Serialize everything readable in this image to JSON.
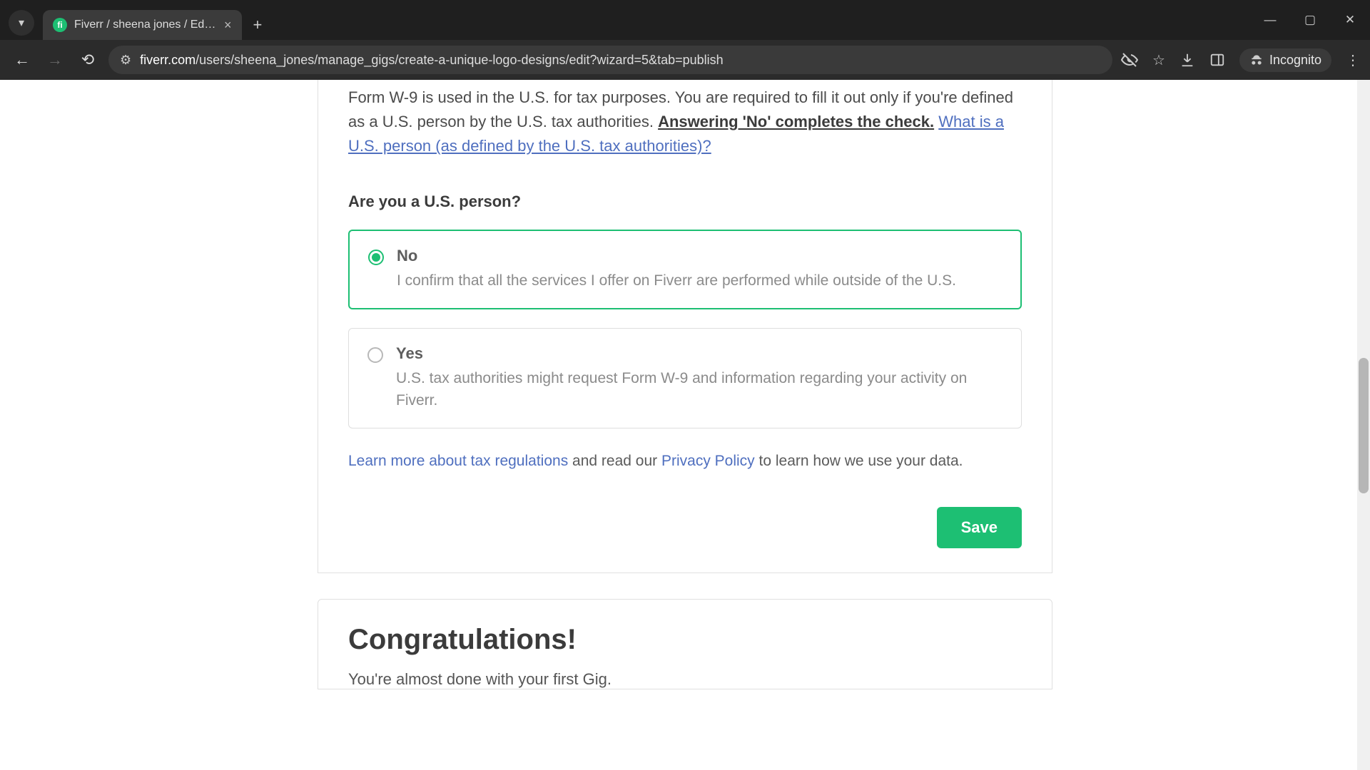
{
  "browser": {
    "tab_title": "Fiverr / sheena jones / Edit Gig",
    "url_host": "fiverr.com",
    "url_path": "/users/sheena_jones/manage_gigs/create-a-unique-logo-designs/edit?wizard=5&tab=publish",
    "incognito_label": "Incognito"
  },
  "form": {
    "intro_pre": "Form W-9 is used in the U.S. for tax purposes. You are required to fill it out only if you're defined as a U.S. person by the U.S. tax authorities. ",
    "intro_emph": "Answering 'No' completes the check.",
    "intro_link": "What is a U.S. person (as defined by the U.S. tax authorities)?",
    "question": "Are you a U.S. person?",
    "option_no": {
      "label": "No",
      "desc": "I confirm that all the services I offer on Fiverr are performed while outside of the U.S."
    },
    "option_yes": {
      "label": "Yes",
      "desc": "U.S. tax authorities might request Form W-9 and information regarding your activity on Fiverr."
    },
    "learn_link1": "Learn more about tax regulations",
    "learn_mid": " and read our ",
    "learn_link2": "Privacy Policy",
    "learn_tail": " to learn how we use your data.",
    "save_label": "Save"
  },
  "congrats": {
    "heading": "Congratulations!",
    "subline": "You're almost done with your first Gig."
  }
}
